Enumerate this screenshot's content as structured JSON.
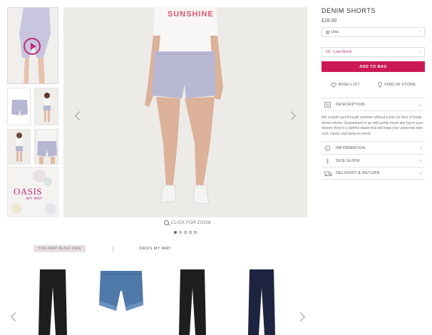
{
  "product": {
    "title": "DENIM SHORTS",
    "price": "£28.00",
    "colour": "Lilac",
    "size": "16 - Low Stock",
    "add_to_bag": "ADD TO BAG",
    "wishlist": "WISH LIST",
    "find_in_store": "FIND IN STORE",
    "tshirt_text": "SUNSHINE"
  },
  "accordion": {
    "description": "DESCRIPTION",
    "description_text": "We couldn't get through summer without a pair (or two) of trusty denim shorts. Guaranteed to go with pretty much any top in your drawer, they're a faithful staple that will keep your seasonal style cool, classy and bang-on-trend.",
    "information": "INFORMATION",
    "size_guide": "SIZE GUIDE",
    "delivery": "DELIVERY & RETURN"
  },
  "gallery": {
    "zoom_label": "CLICK FOR ZOOM",
    "promo_title": "OASIS",
    "promo_sub": "MY WAY"
  },
  "recommendations": {
    "tab_active": "YOU MAY ALSO LIKE",
    "tab_other": "OASIS MY WAY"
  },
  "colors": {
    "accent": "#cc1956",
    "shorts": "#b9b8d4",
    "denim_blue": "#4f79a9",
    "black": "#1e1e1e",
    "navy": "#1d2440"
  }
}
